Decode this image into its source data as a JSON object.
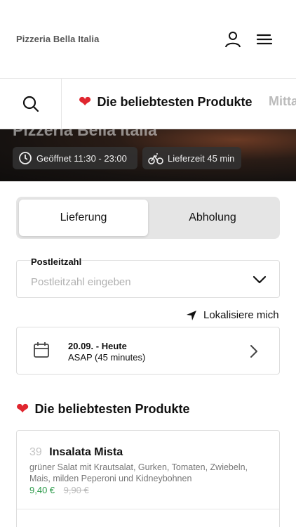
{
  "header": {
    "brand": "Pizzeria Bella Italia",
    "icons": [
      "user-icon",
      "menu-icon"
    ]
  },
  "category_bar": {
    "search_icon": "search-icon",
    "active_label": "Die beliebtesten Produkte",
    "next_label": "Mitta"
  },
  "hero": {
    "title": "Pizzeria Bella Italia",
    "opening_hours": "Geöffnet 11:30 - 23:00",
    "delivery_time": "Lieferzeit 45 min"
  },
  "order_type": {
    "delivery": "Lieferung",
    "pickup": "Abholung",
    "selected": "Lieferung"
  },
  "zip": {
    "label": "Postleitzahl",
    "placeholder": "Postleitzahl eingeben",
    "value": ""
  },
  "locate": {
    "label": "Lokalisiere mich"
  },
  "date": {
    "main": "20.09. - Heute",
    "sub": "ASAP (45 minutes)"
  },
  "section": {
    "title": "Die beliebtesten Produkte"
  },
  "products": [
    {
      "number": "39",
      "name": "Insalata Mista",
      "description": "grüner Salat mit Krautsalat, Gurken, Tomaten, Zwiebeln, Mais, milden Peperoni und Kidneybohnen",
      "price": "9,40 €",
      "old_price": "9,90 €"
    }
  ],
  "colors": {
    "heart": "#e0262f",
    "price": "#2e9b4c",
    "muted": "#bbbbbb"
  }
}
